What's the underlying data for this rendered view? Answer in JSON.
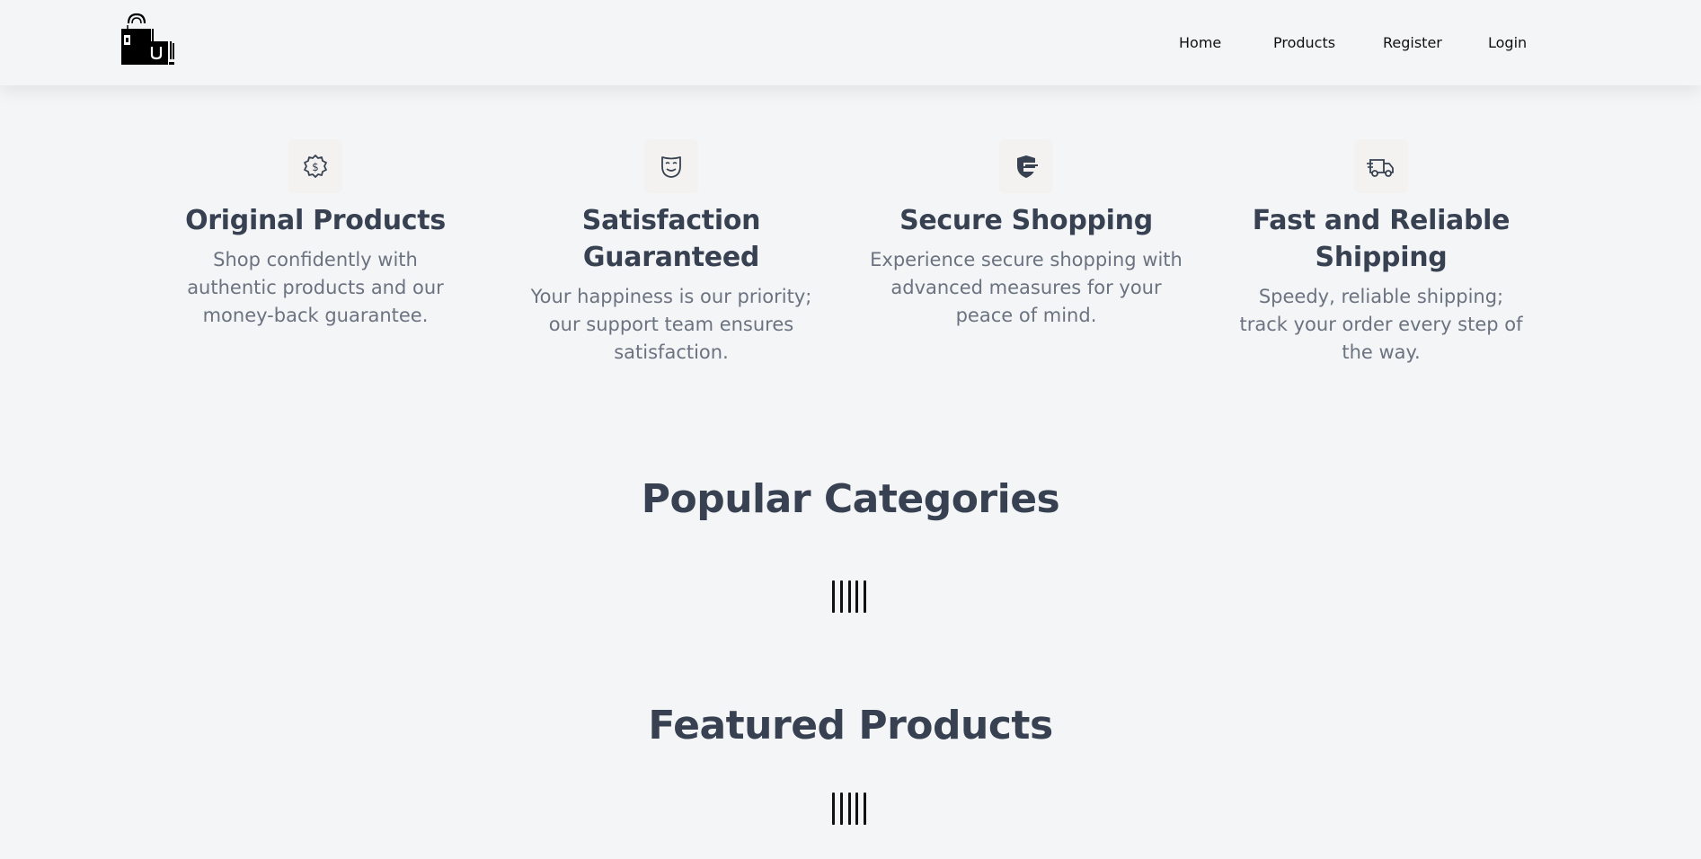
{
  "header": {
    "logo_icon": "shopping-bags-icon",
    "nav": [
      {
        "label": "Home"
      },
      {
        "label": "Products"
      },
      {
        "label": "Register"
      },
      {
        "label": "Login"
      }
    ]
  },
  "features": [
    {
      "icon": "dollar-badge-icon",
      "title": "Original Products",
      "desc": "Shop confidently with authentic products and our money-back guarantee."
    },
    {
      "icon": "smile-mask-icon",
      "title": "Satisfaction Guaranteed",
      "desc": "Your happiness is our priority; our support team ensures satisfaction."
    },
    {
      "icon": "shield-card-icon",
      "title": "Secure Shopping",
      "desc": "Experience secure shopping with advanced measures for your peace of mind."
    },
    {
      "icon": "truck-icon",
      "title": "Fast and Reliable Shipping",
      "desc": "Speedy, reliable shipping; track your order every step of the way."
    }
  ],
  "sections": {
    "popular_title": "Popular Categories",
    "featured_title": "Featured Products"
  },
  "colors": {
    "background": "#f4f5f7",
    "heading": "#374151",
    "body_text": "#6b7280",
    "nav_text": "#111111"
  }
}
